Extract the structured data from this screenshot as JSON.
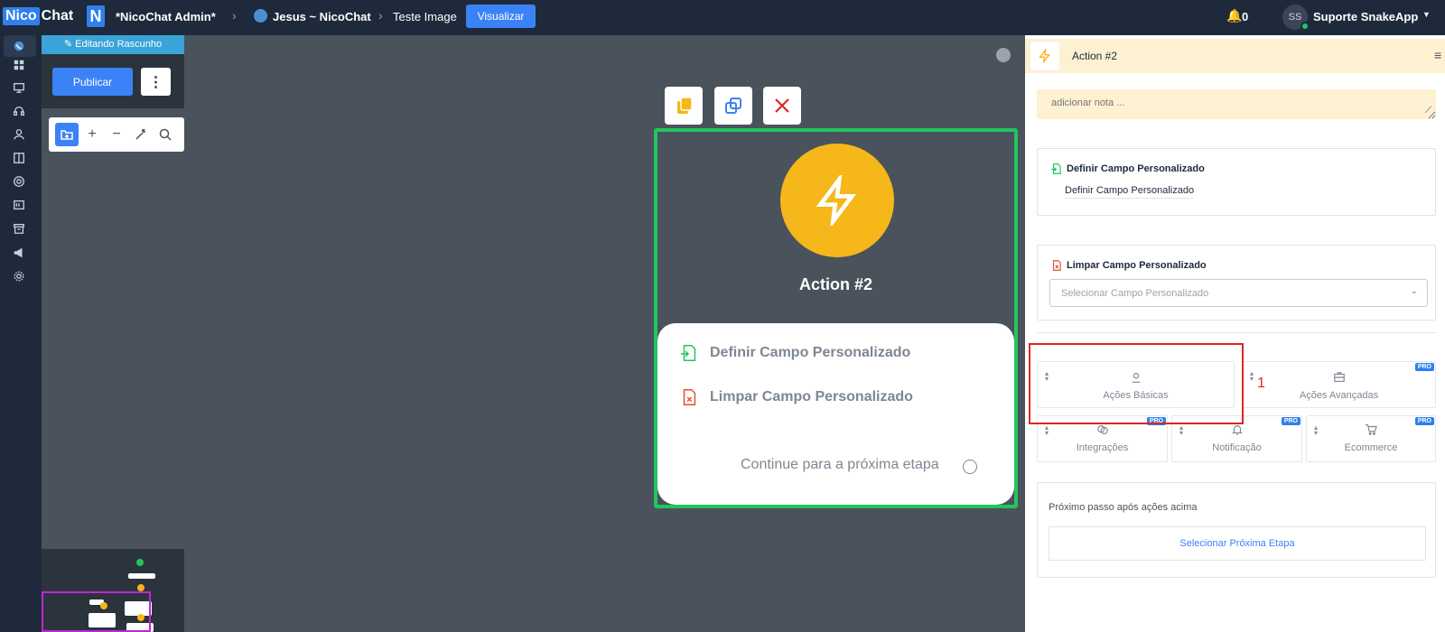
{
  "topbar": {
    "logo_left": "Nico",
    "logo_right": "Chat",
    "n_badge": "N",
    "breadcrumb": [
      "*NicoChat Admin*",
      "Jesus ~ NicoChat",
      "Teste Image"
    ],
    "visualize_button": "Visualizar",
    "notifications_count": "0",
    "avatar_initials": "SS",
    "user_name": "Suporte SnakeApp"
  },
  "rail_icons": [
    "whatsapp-icon",
    "dashboard-icon",
    "presentation-icon",
    "headset-icon",
    "user-icon",
    "columns-icon",
    "lifebuoy-icon",
    "template-icon",
    "archive-icon",
    "megaphone-icon",
    "settings-icon"
  ],
  "editor": {
    "draft_banner": "Editando Rascunho",
    "publish_button": "Publicar",
    "more_button": "⋮"
  },
  "node": {
    "title": "Action #2",
    "actions": [
      "Definir Campo Personalizado",
      "Limpar Campo Personalizado"
    ],
    "continue_text": "Continue para a próxima etapa"
  },
  "panel": {
    "title": "Action #2",
    "note_placeholder": "adicionar nota ...",
    "set_field": {
      "heading": "Definir Campo Personalizado",
      "value": "Definir Campo Personalizado"
    },
    "clear_field": {
      "heading": "Limpar Campo Personalizado",
      "select_placeholder": "Selecionar Campo Personalizado"
    },
    "tiles": [
      {
        "label": "Ações Básicas",
        "pro": ""
      },
      {
        "label": "Ações Avançadas",
        "pro": "PRO"
      },
      {
        "label": "Integrações",
        "pro": "PRO"
      },
      {
        "label": "Notificação",
        "pro": "PRO"
      },
      {
        "label": "Ecommerce",
        "pro": "PRO"
      }
    ],
    "next_step_label": "Próximo passo após ações acima",
    "next_step_button": "Selecionar Próxima Etapa"
  },
  "annotation": {
    "number": "1"
  },
  "colors": {
    "topbar_bg": "#1e2a3b",
    "canvas_bg": "#4a525c",
    "accent_blue": "#3b82f6",
    "node_border": "#22c55e",
    "action_yellow": "#f5b719",
    "highlight_red": "#dc2626"
  }
}
